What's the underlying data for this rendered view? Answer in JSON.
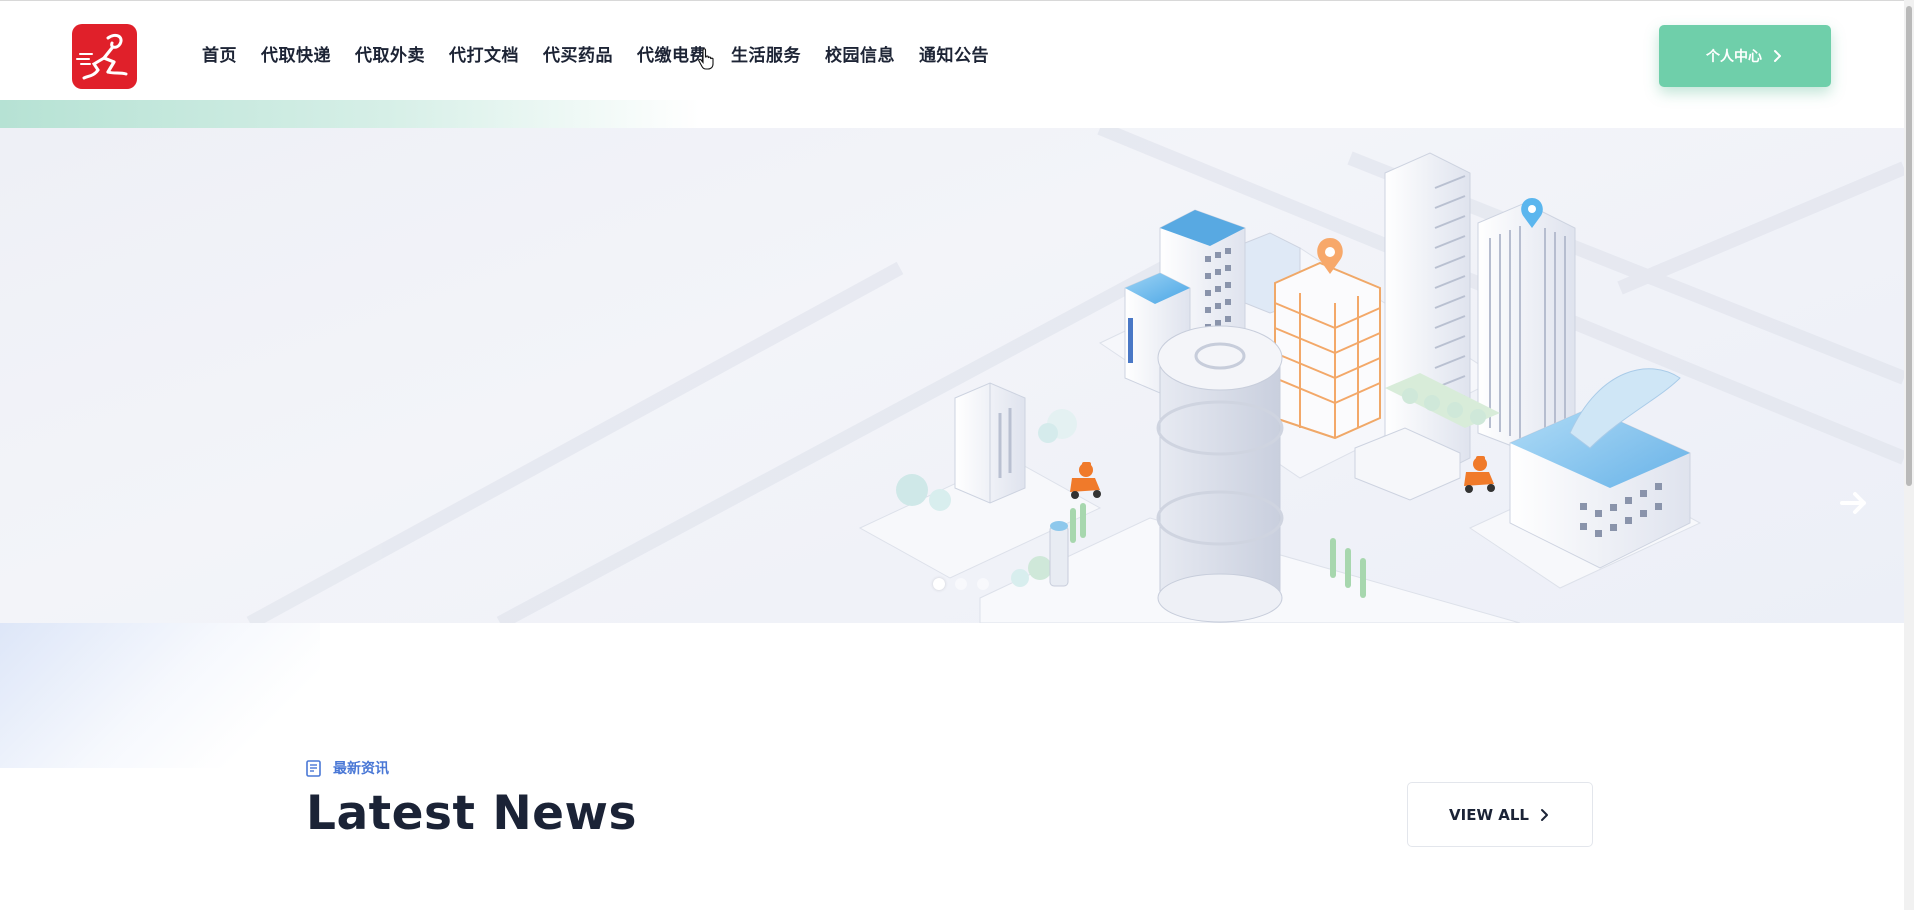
{
  "header": {
    "logo": "courier-runner-logo",
    "nav": [
      "首页",
      "代取快递",
      "代取外卖",
      "代打文档",
      "代买药品",
      "代缴电费",
      "生活服务",
      "校园信息",
      "通知公告"
    ],
    "cta_label": "个人中心"
  },
  "hero": {
    "slide_count": 3,
    "active_slide": 1
  },
  "news": {
    "tag": "最新资讯",
    "title": "Latest News",
    "view_all": "VIEW ALL"
  },
  "colors": {
    "accent_green": "#6fcfaa",
    "brand_red": "#e0202a",
    "tag_blue": "#4a78d6",
    "text_dark": "#1b2336",
    "delivery_orange": "#f07a2a"
  }
}
